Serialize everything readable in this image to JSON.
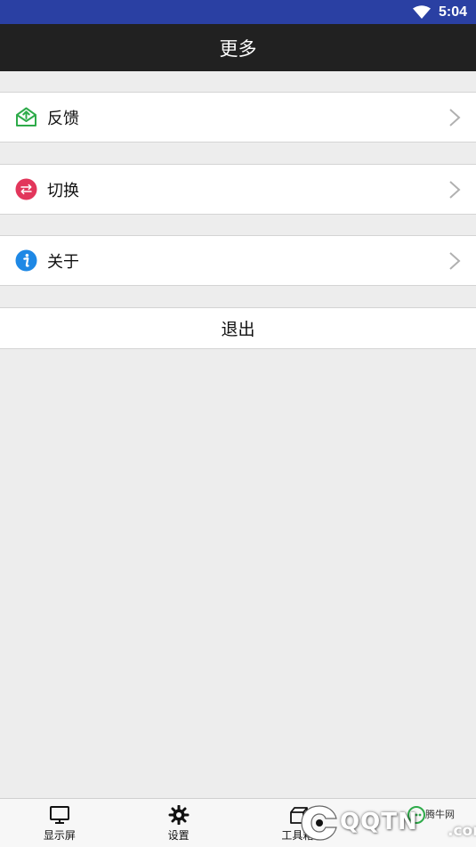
{
  "status_bar": {
    "time": "5:04",
    "wifi_icon": "wifi-icon"
  },
  "header": {
    "title": "更多"
  },
  "menu": {
    "items": [
      {
        "label": "反馈",
        "icon": "feedback-envelope-icon",
        "icon_color": "#2eab4a"
      },
      {
        "label": "切换",
        "icon": "switch-arrows-icon",
        "icon_color": "#e2365b"
      },
      {
        "label": "关于",
        "icon": "info-icon",
        "icon_color": "#1e88e5"
      }
    ],
    "logout_label": "退出"
  },
  "tabbar": {
    "tabs": [
      {
        "label": "显示屏",
        "icon": "monitor-icon"
      },
      {
        "label": "设置",
        "icon": "gear-icon"
      },
      {
        "label": "工具箱",
        "icon": "toolbox-icon"
      },
      {
        "label": "",
        "icon": "more-icon"
      }
    ]
  },
  "watermark": {
    "brand": "QQTN",
    "site": "腾牛网",
    "suffix": ".com"
  },
  "colors": {
    "status_bar": "#2a40a3",
    "title_bar": "#212121",
    "background": "#ededed"
  }
}
